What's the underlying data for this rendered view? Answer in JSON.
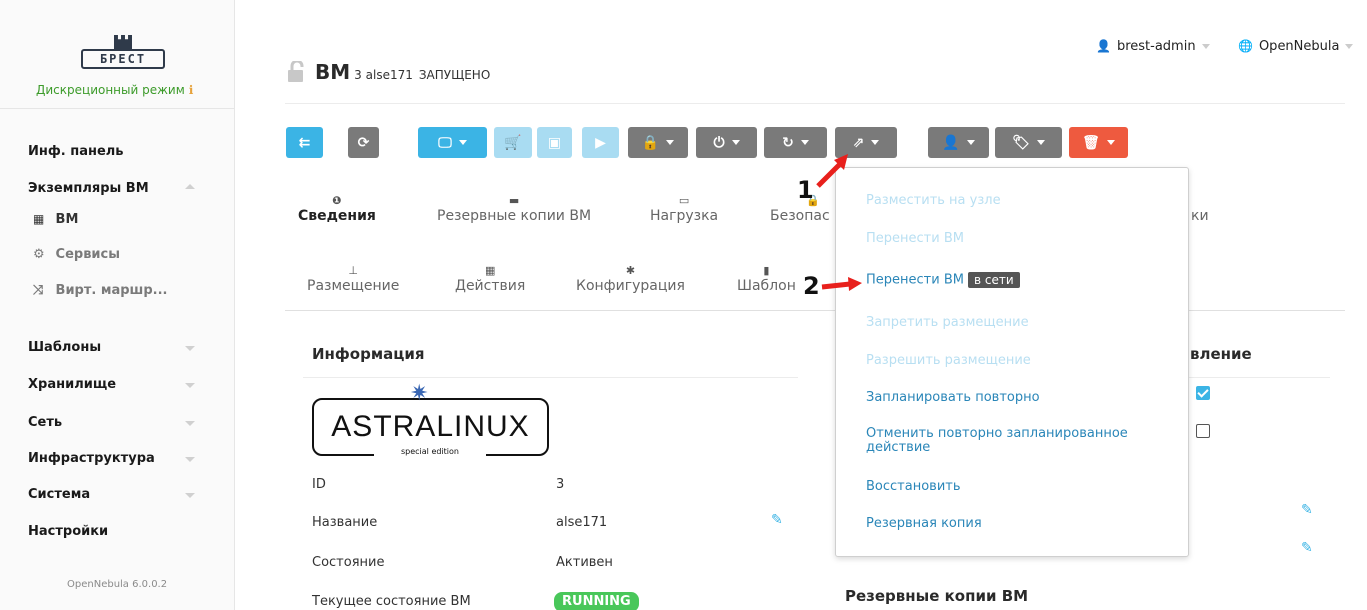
{
  "sidebar": {
    "logo_text": "БРЕСТ",
    "mode_label": "Дискреционный режим",
    "mode_info_icon": "info-icon",
    "items": [
      {
        "label": "Инф. панель"
      },
      {
        "label": "Экземпляры ВМ"
      },
      {
        "label": "ВМ",
        "icon": "grid-icon"
      },
      {
        "label": "Сервисы",
        "icon": "services-icon"
      },
      {
        "label": "Вирт. маршр...",
        "icon": "shuffle-icon"
      },
      {
        "label": "Шаблоны"
      },
      {
        "label": "Хранилище"
      },
      {
        "label": "Сеть"
      },
      {
        "label": "Инфраструктура"
      },
      {
        "label": "Система"
      },
      {
        "label": "Настройки"
      }
    ],
    "version": "OpenNebula 6.0.0.2"
  },
  "topbar": {
    "user": "brest-admin",
    "zone": "OpenNebula"
  },
  "header": {
    "title": "ВМ",
    "vm_id": "3",
    "vm_name": "alse171",
    "state": "ЗАПУЩЕНО"
  },
  "toolbar": {
    "buttons": [
      "back-icon",
      "refresh-icon",
      "monitor-icon",
      "cart-icon",
      "save-icon",
      "play-icon",
      "lock-icon",
      "power-icon",
      "reboot-icon",
      "migrate-icon",
      "user-icon",
      "tag-icon",
      "trash-icon"
    ]
  },
  "tabs": {
    "row1": [
      {
        "label": "Сведения",
        "icon": "info-icon"
      },
      {
        "label": "Резервные копии ВМ",
        "icon": "archive-icon"
      },
      {
        "label": "Нагрузка",
        "icon": "laptop-icon"
      },
      {
        "label": "Безопас",
        "icon": "lock-icon"
      },
      {
        "label": "ки"
      }
    ],
    "row2": [
      {
        "label": "Размещение",
        "icon": "sitemap-icon"
      },
      {
        "label": "Действия",
        "icon": "calendar-icon"
      },
      {
        "label": "Конфигурация",
        "icon": "gear-icon"
      },
      {
        "label": "Шаблон",
        "icon": "file-icon"
      }
    ]
  },
  "info": {
    "section_title": "Информация",
    "logo_text": "ASTRALINUX",
    "logo_sub": "special edition",
    "rows": [
      {
        "label": "ID",
        "value": "3"
      },
      {
        "label": "Название",
        "value": "alse171"
      },
      {
        "label": "Состояние",
        "value": "Активен"
      },
      {
        "label": "Текущее состояние ВМ",
        "value": "RUNNING"
      }
    ]
  },
  "right_panel": {
    "partial_title": "вление",
    "backups_title": "Резервные копии ВМ",
    "checkbox1": true,
    "checkbox2": false
  },
  "dropdown": {
    "items": [
      {
        "label": "Разместить на узле",
        "enabled": false
      },
      {
        "label": "Перенести ВМ",
        "enabled": false
      },
      {
        "label": "Перенести ВМ",
        "enabled": true,
        "tooltip": "в сети"
      },
      {
        "label": "Запретить размещение",
        "enabled": false
      },
      {
        "label": "Разрешить размещение",
        "enabled": false
      },
      {
        "label": "Запланировать повторно",
        "enabled": true
      },
      {
        "label": "Отменить повторно запланированное",
        "label2": "действие",
        "enabled": true
      },
      {
        "label": "Восстановить",
        "enabled": true
      },
      {
        "label": "Резервная копия",
        "enabled": true
      }
    ]
  },
  "annotations": {
    "one": "1",
    "two": "2",
    "color": "#e8201c"
  }
}
